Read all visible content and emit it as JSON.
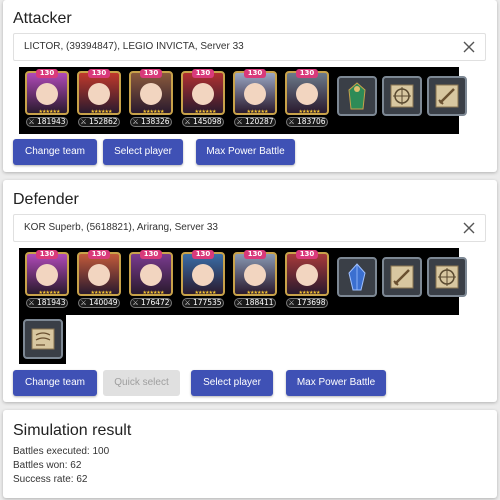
{
  "attacker": {
    "title": "Attacker",
    "player": "LICTOR, (39394847), LEGIO INVICTA, Server 33",
    "heroes": [
      {
        "level": "130",
        "power": "181943",
        "color": "#b04ab8"
      },
      {
        "level": "130",
        "power": "152862",
        "color": "#c0392b"
      },
      {
        "level": "130",
        "power": "138326",
        "color": "#8a5a3c"
      },
      {
        "level": "130",
        "power": "145098",
        "color": "#b03030"
      },
      {
        "level": "130",
        "power": "120287",
        "color": "#9aa7c4"
      },
      {
        "level": "130",
        "power": "183706",
        "color": "#6c7a8a"
      }
    ],
    "items": [
      "green-cloak-icon",
      "rune-compass-icon",
      "sword-scroll-icon"
    ],
    "buttons": {
      "change_team": "Change team",
      "select_player": "Select player",
      "max_power": "Max Power Battle"
    }
  },
  "defender": {
    "title": "Defender",
    "player": "KOR Superb, (5618821), Arirang, Server 33",
    "heroes": [
      {
        "level": "130",
        "power": "181943",
        "color": "#b04ab8"
      },
      {
        "level": "130",
        "power": "140049",
        "color": "#c25a3a"
      },
      {
        "level": "130",
        "power": "176472",
        "color": "#7a3b8f"
      },
      {
        "level": "130",
        "power": "177535",
        "color": "#3a6ea8"
      },
      {
        "level": "130",
        "power": "188411",
        "color": "#8a9ab4"
      },
      {
        "level": "130",
        "power": "173698",
        "color": "#a83a3a"
      }
    ],
    "items": [
      "blue-crystal-icon",
      "sword-scroll-icon",
      "rune-compass-icon",
      "scroll-map-icon"
    ],
    "buttons": {
      "change_team": "Change team",
      "quick_select": "Quick select",
      "select_player": "Select player",
      "max_power": "Max Power Battle"
    }
  },
  "result": {
    "title": "Simulation result",
    "battles_executed": "Battles executed: 100",
    "battles_won": "Battles won: 62",
    "success_rate": "Success rate: 62"
  },
  "colors": {
    "primary": "#3f51b5",
    "disabled": "#e0e0e0",
    "level_badge": "#d93a7b"
  }
}
